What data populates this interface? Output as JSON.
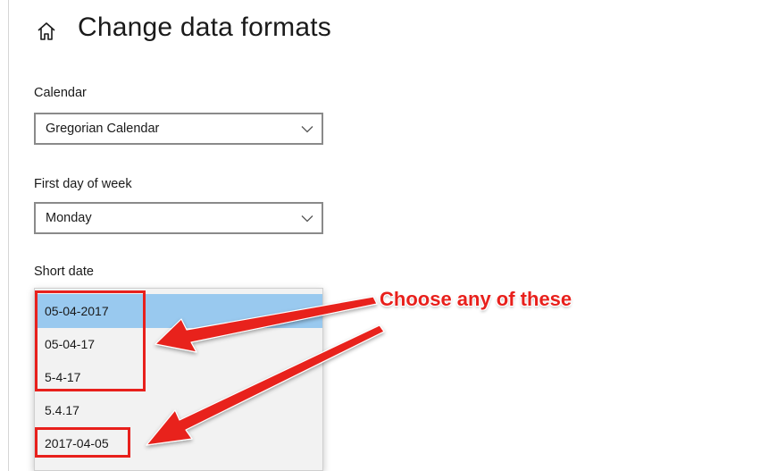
{
  "header": {
    "home_icon": "home-icon",
    "title": "Change data formats"
  },
  "calendar": {
    "label": "Calendar",
    "value": "Gregorian Calendar",
    "chevron_icon": "chevron-down-icon"
  },
  "first_day_of_week": {
    "label": "First day of week",
    "value": "Monday",
    "chevron_icon": "chevron-down-icon"
  },
  "short_date": {
    "label": "Short date",
    "options": [
      "05-04-2017",
      "05-04-17",
      "5-4-17",
      "5.4.17",
      "2017-04-05"
    ],
    "selected": "05-04-2017"
  },
  "annotation": {
    "text": "Choose any of these",
    "color": "#e8201c"
  },
  "colors": {
    "selected_highlight": "#99c9ef",
    "annotation_red": "#e8201c"
  }
}
